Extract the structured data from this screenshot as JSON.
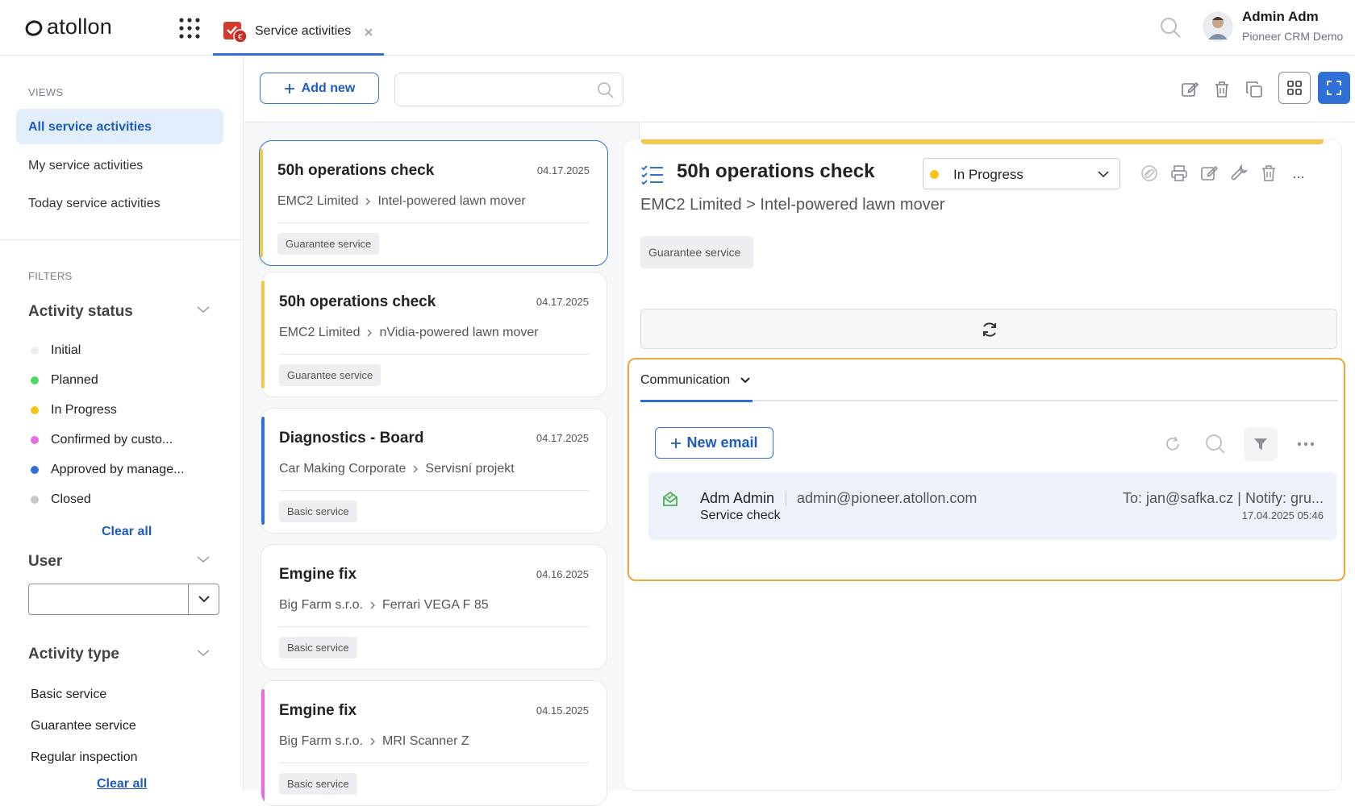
{
  "app": {
    "logo_text": "atollon",
    "tab_label": "Service activities",
    "user_name": "Admin Adm",
    "user_org": "Pioneer CRM Demo"
  },
  "sidebar": {
    "views_heading": "VIEWS",
    "views": [
      {
        "label": "All service activities",
        "active": true
      },
      {
        "label": "My service activities",
        "active": false
      },
      {
        "label": "Today service activities",
        "active": false
      }
    ],
    "filters_heading": "FILTERS",
    "activity_status": {
      "heading": "Activity status",
      "items": [
        {
          "label": "Initial",
          "color": "#eeeeee"
        },
        {
          "label": "Planned",
          "color": "#4cd964"
        },
        {
          "label": "In Progress",
          "color": "#f5c518"
        },
        {
          "label": "Confirmed by custo...",
          "color": "#e86ce0"
        },
        {
          "label": "Approved by manage...",
          "color": "#2f6fd6"
        },
        {
          "label": "Closed",
          "color": "#c8c8c8"
        }
      ],
      "clear_label": "Clear all"
    },
    "user": {
      "heading": "User",
      "value": ""
    },
    "activity_type": {
      "heading": "Activity type",
      "items": [
        "Basic service",
        "Guarantee service",
        "Regular inspection"
      ],
      "clear_label": "Clear all"
    }
  },
  "list": {
    "add_label": "Add new",
    "search_placeholder": "",
    "cards": [
      {
        "title": "50h operations check",
        "date": "04.17.2025",
        "company": "EMC2 Limited",
        "item": "Intel-powered lawn mover",
        "tag": "Guarantee service",
        "color": "#f2c94c",
        "selected": true
      },
      {
        "title": "50h operations check",
        "date": "04.17.2025",
        "company": "EMC2 Limited",
        "item": "nVidia-powered lawn mover",
        "tag": "Guarantee service",
        "color": "#f2c94c",
        "selected": false
      },
      {
        "title": "Diagnostics - Board",
        "date": "04.17.2025",
        "company": "Car Making Corporate",
        "item": "Servisní projekt",
        "tag": "Basic service",
        "color": "#2f6fd6",
        "selected": false
      },
      {
        "title": "Emgine fix",
        "date": "04.16.2025",
        "company": "Big Farm s.r.o.",
        "item": "Ferrari VEGA F 85",
        "tag": "Basic service",
        "color": "#ffffff",
        "selected": false
      },
      {
        "title": "Emgine fix",
        "date": "04.15.2025",
        "company": "Big Farm s.r.o.",
        "item": "MRI Scanner Z",
        "tag": "Basic service",
        "color": "#e86ce0",
        "selected": false
      }
    ]
  },
  "detail": {
    "title": "50h operations check",
    "breadcrumb": "EMC2 Limited > Intel-powered lawn mover",
    "status": "In Progress",
    "status_color": "#f5c518",
    "tag": "Guarantee service",
    "more_label": "...",
    "communication": {
      "tab_label": "Communication",
      "new_email_label": "New email",
      "emails": [
        {
          "from": "Adm Admin",
          "address": "admin@pioneer.atollon.com",
          "subject": "Service check",
          "to": "To: jan@safka.cz | Notify: gru...",
          "date": "17.04.2025 05:46"
        }
      ]
    }
  }
}
